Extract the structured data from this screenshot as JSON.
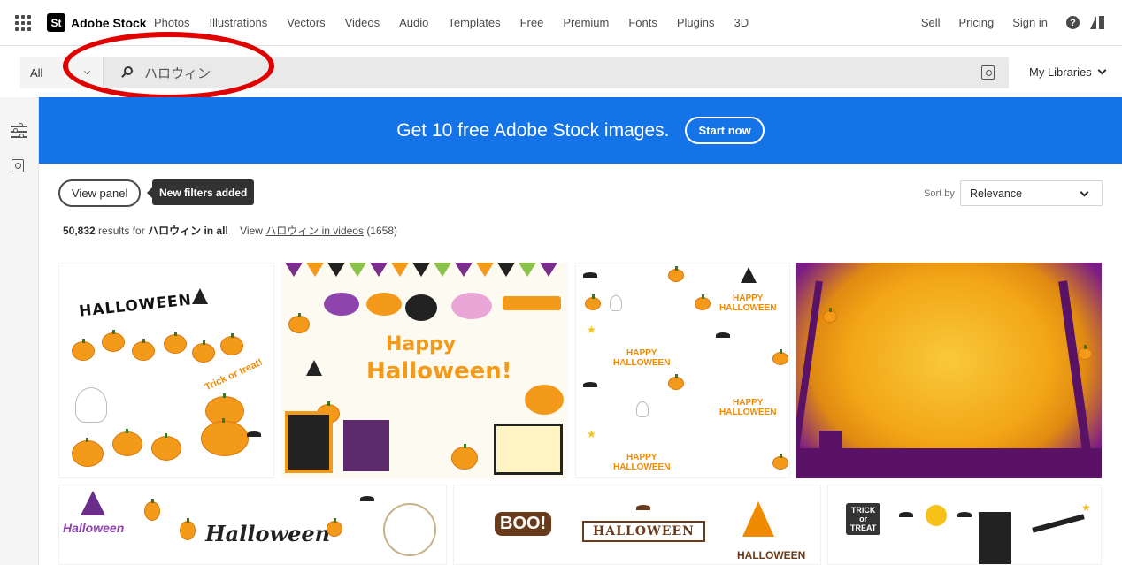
{
  "nav": {
    "brand": "Adobe Stock",
    "logo_text": "St",
    "links": [
      "Photos",
      "Illustrations",
      "Vectors",
      "Videos",
      "Audio",
      "Templates",
      "Free",
      "Premium",
      "Fonts",
      "Plugins",
      "3D"
    ],
    "right": {
      "sell": "Sell",
      "pricing": "Pricing",
      "sign_in": "Sign in",
      "help": "?"
    }
  },
  "search": {
    "scope": "All",
    "query": "ハロウィン",
    "my_libraries": "My Libraries"
  },
  "promo": {
    "text": "Get 10 free Adobe Stock images.",
    "button": "Start now",
    "color": "#1473e6"
  },
  "toolbar": {
    "view_panel": "View panel",
    "tooltip": "New filters added",
    "sort_label": "Sort by",
    "sort_value": "Relevance"
  },
  "results": {
    "count": "50,832",
    "results_for": "results for",
    "query": "ハロウィン",
    "in_all": "in all",
    "view": "View",
    "video_link": "ハロウィン in videos",
    "video_count": "(1658)"
  },
  "tiles": {
    "t1_title": "HALLOWEEN",
    "t1_trick": "Trick or treat!",
    "t2_happy": "Happy",
    "t2_halloween": "Halloween!",
    "t3_happy_halloween": "HAPPY\nHALLOWEEN",
    "t5_text": "Halloween",
    "t6_boo": "BOO!",
    "t6_banner": "HALLOWEEN",
    "t6_hw": "HALLOWEEN",
    "t7_sign": "TRICK\nor\nTREAT"
  },
  "icons": {
    "apps": "apps-grid-icon",
    "search": "search-icon",
    "visual_search": "visual-search-icon",
    "filters": "filters-icon",
    "help": "help-icon",
    "adobe": "adobe-logo-icon"
  },
  "annotation_color": "#e00000"
}
